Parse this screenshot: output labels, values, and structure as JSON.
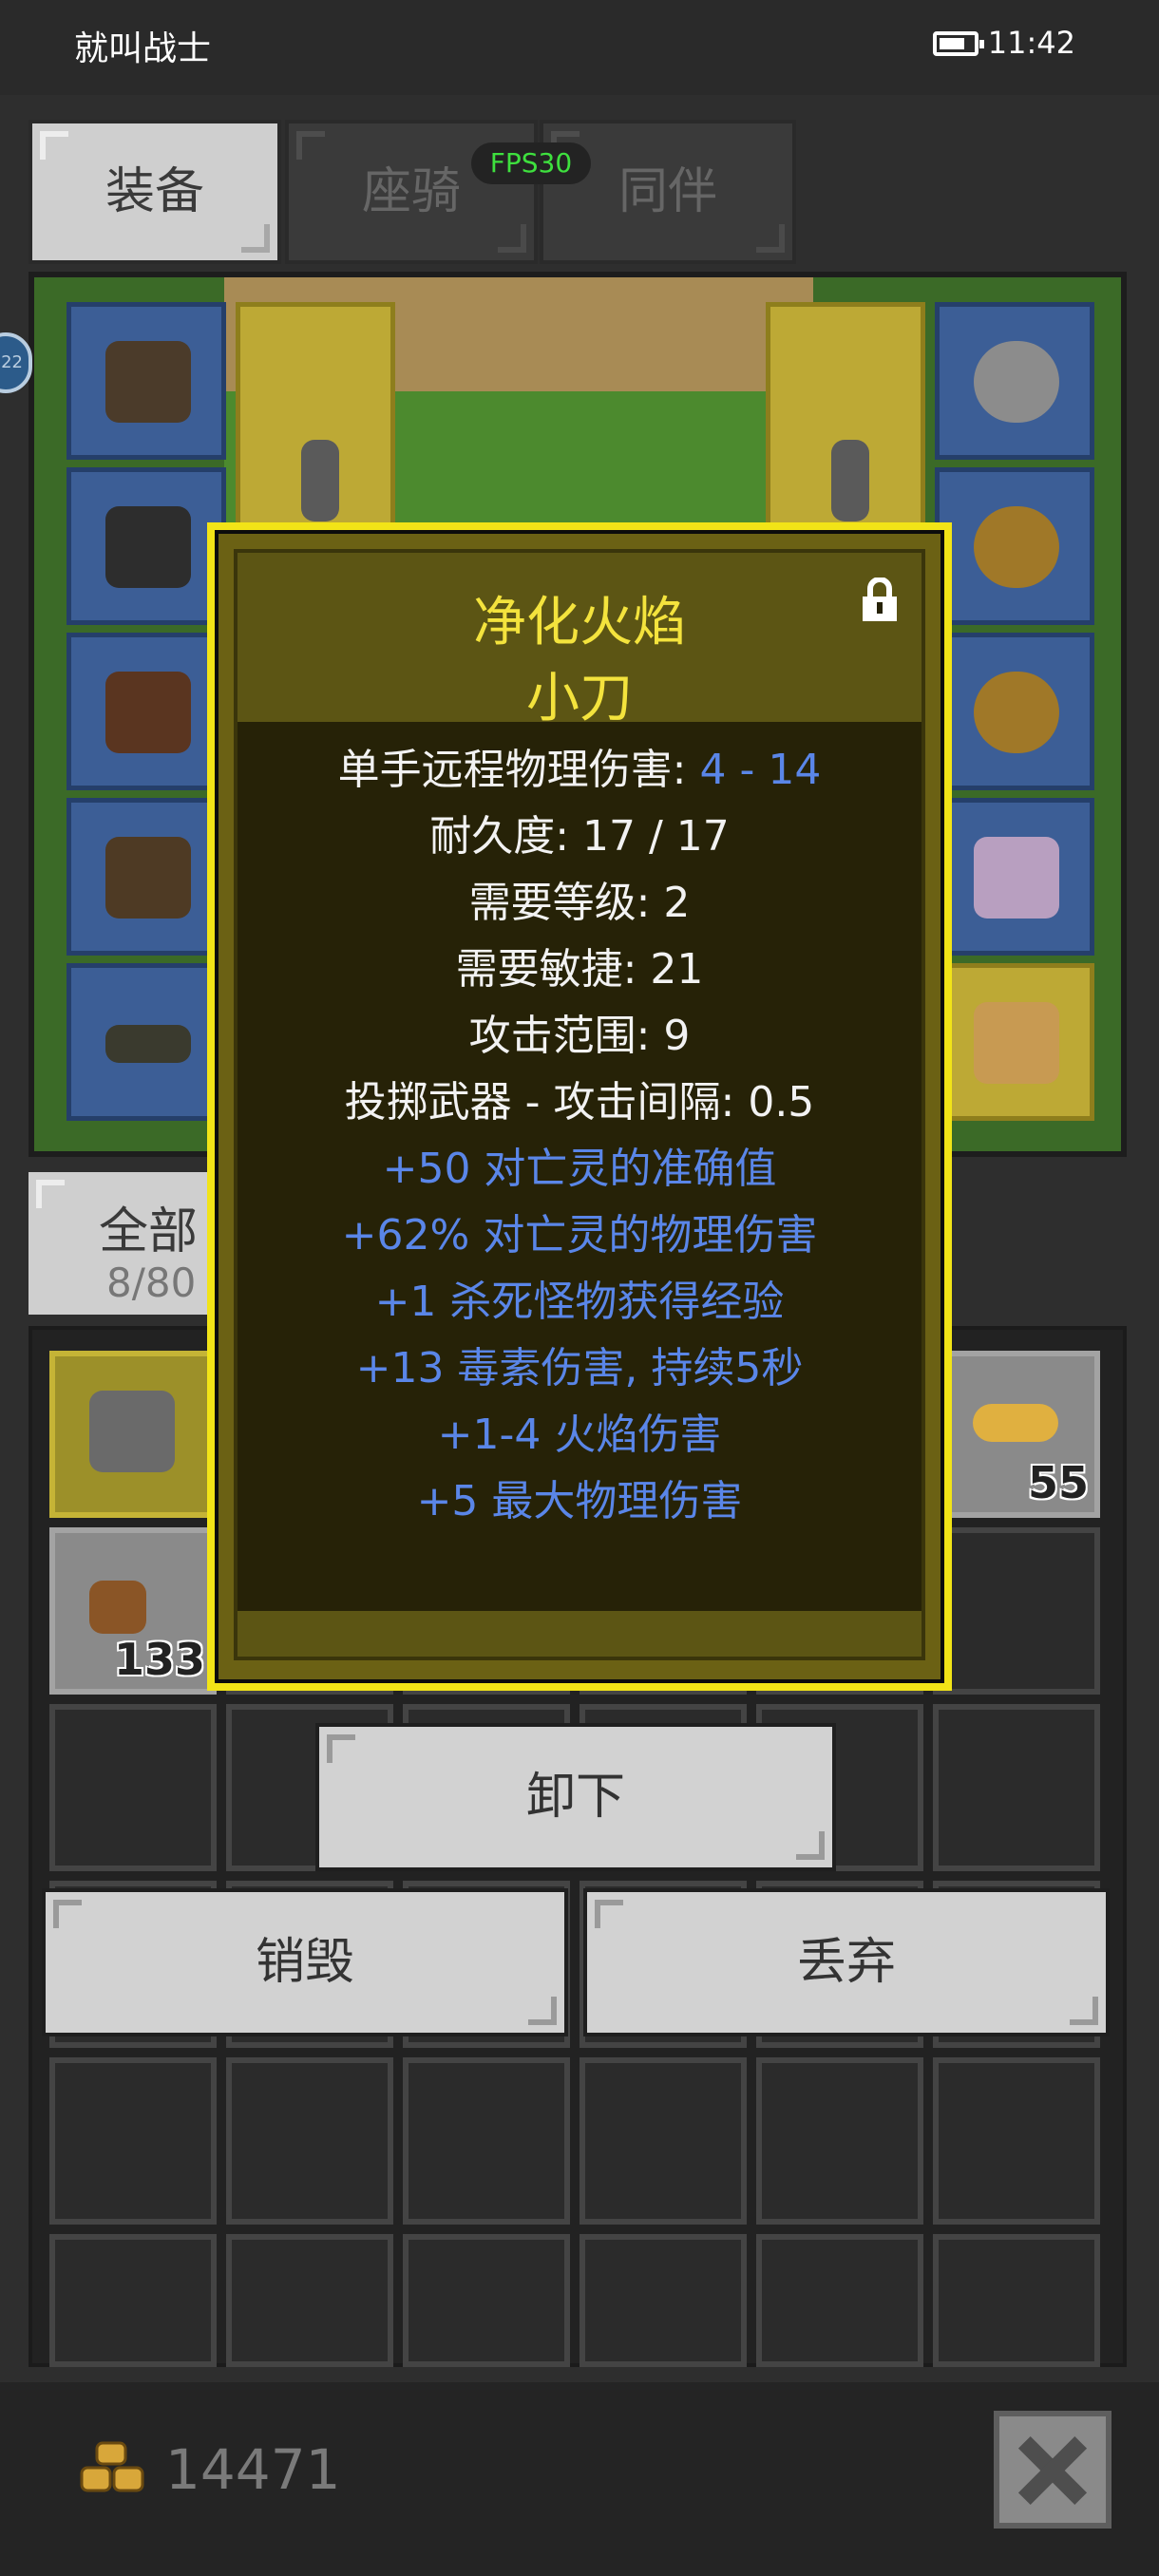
{
  "statusbar": {
    "title": "就叫战士",
    "time": "11:42"
  },
  "tabs": [
    {
      "label": "装备",
      "active": true
    },
    {
      "label": "座骑",
      "active": false
    },
    {
      "label": "同伴",
      "active": false
    }
  ],
  "fps": "FPS30",
  "side_badge": "22",
  "filter": {
    "label": "全部",
    "count": "8/80"
  },
  "inventory": {
    "quantities": {
      "food": "133",
      "cheese": "55"
    }
  },
  "tooltip": {
    "item_name": "净化火焰",
    "item_type": "小刀",
    "stats": [
      {
        "label": "单手远程物理伤害: ",
        "value": "4 - 14"
      },
      {
        "label": "耐久度: 17 / 17"
      },
      {
        "label": "需要等级: 2"
      },
      {
        "label": "需要敏捷: 21"
      },
      {
        "label": "攻击范围: 9"
      },
      {
        "label": "投掷武器 - 攻击间隔: 0.5"
      }
    ],
    "affixes": [
      "+50 对亡灵的准确值",
      "+62% 对亡灵的物理伤害",
      "+1 杀死怪物获得经验",
      "+13 毒素伤害, 持续5秒",
      "+1-4 火焰伤害",
      "+5 最大物理伤害"
    ]
  },
  "buttons": {
    "unequip": "卸下",
    "destroy": "销毁",
    "discard": "丢弃"
  },
  "gold": "14471",
  "colors": {
    "item_name": "#f4e33d",
    "affix_blue": "#5a86e8",
    "fps_green": "#3ee03e",
    "popup_border": "#f2e417"
  }
}
